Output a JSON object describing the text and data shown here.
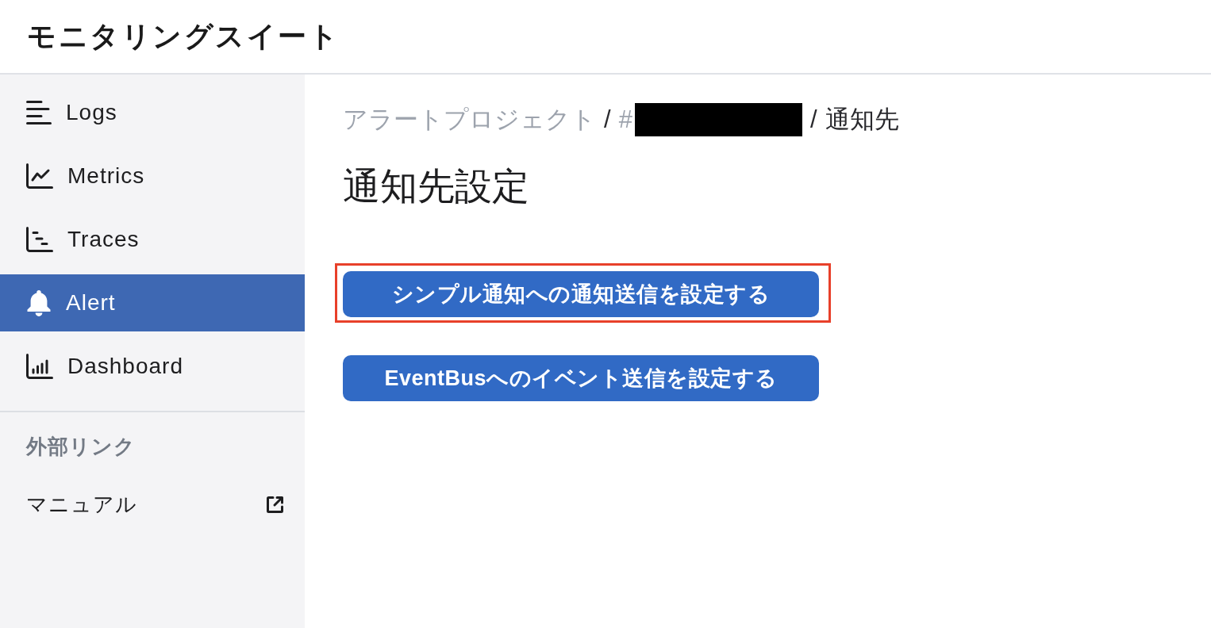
{
  "app_title": "モニタリングスイート",
  "sidebar": {
    "items": [
      {
        "label": "Logs",
        "selected": false
      },
      {
        "label": "Metrics",
        "selected": false
      },
      {
        "label": "Traces",
        "selected": false
      },
      {
        "label": "Alert",
        "selected": true
      },
      {
        "label": "Dashboard",
        "selected": false
      }
    ],
    "external_links": {
      "heading": "外部リンク",
      "items": [
        {
          "label": "マニュアル"
        }
      ]
    }
  },
  "breadcrumb": [
    {
      "kind": "link",
      "text": "アラートプロジェクト",
      "redacted": false
    },
    {
      "kind": "link",
      "text": "#",
      "redacted": true,
      "separator": "/"
    },
    {
      "kind": "current",
      "text": "通知先",
      "redacted": false,
      "separator": "/"
    }
  ],
  "page_title": "通知先設定",
  "actions": [
    {
      "label": "シンプル通知への通知送信を設定する",
      "highlighted": true
    },
    {
      "label": "EventBusへのイベント送信を設定する",
      "highlighted": false
    }
  ]
}
